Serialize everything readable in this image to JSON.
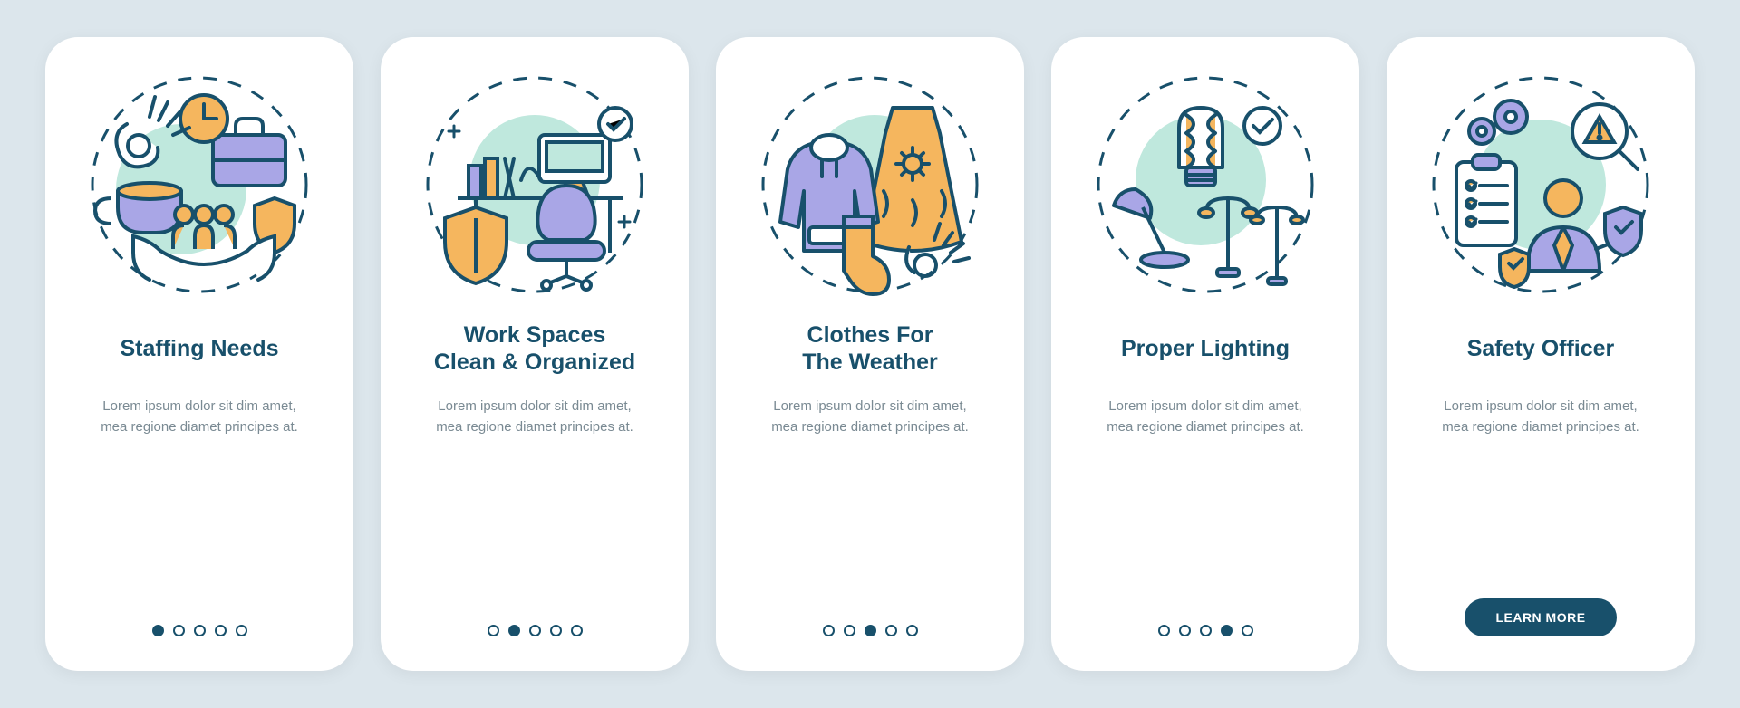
{
  "colors": {
    "page_bg": "#dce6ec",
    "card_bg": "#ffffff",
    "title": "#18506b",
    "body": "#7a8a93",
    "stroke": "#18506b",
    "mint": "#bfe8dd",
    "lavender": "#a9a6e6",
    "orange": "#f5b65e",
    "cta_bg": "#18506b",
    "cta_text": "#ffffff"
  },
  "total_steps": 5,
  "placeholder_body": "Lorem ipsum dolor sit dim amet, mea regione diamet principes at.",
  "screens": [
    {
      "step": 1,
      "title": "Staffing Needs",
      "body": "Lorem ipsum dolor sit dim amet, mea regione diamet principes at.",
      "illustration": "staffing-needs",
      "has_cta": false
    },
    {
      "step": 2,
      "title": "Work Spaces\nClean & Organized",
      "body": "Lorem ipsum dolor sit dim amet, mea regione diamet principes at.",
      "illustration": "workspace-clean",
      "has_cta": false
    },
    {
      "step": 3,
      "title": "Clothes For\nThe Weather",
      "body": "Lorem ipsum dolor sit dim amet, mea regione diamet principes at.",
      "illustration": "weather-clothes",
      "has_cta": false
    },
    {
      "step": 4,
      "title": "Proper Lighting",
      "body": "Lorem ipsum dolor sit dim amet, mea regione diamet principes at.",
      "illustration": "proper-lighting",
      "has_cta": false
    },
    {
      "step": 5,
      "title": "Safety Officer",
      "body": "Lorem ipsum dolor sit dim amet, mea regione diamet principes at.",
      "illustration": "safety-officer",
      "has_cta": true,
      "cta_label": "LEARN MORE"
    }
  ]
}
